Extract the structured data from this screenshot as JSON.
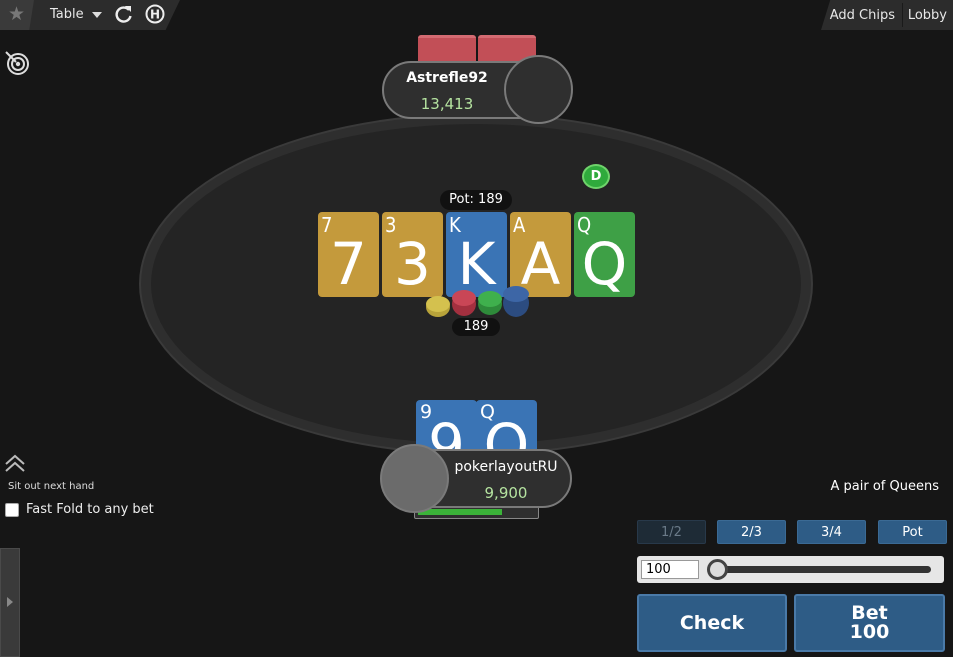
{
  "toolbar": {
    "table_label": "Table",
    "add_chips_label": "Add Chips",
    "lobby_label": "Lobby",
    "icons": [
      "star-icon",
      "caret-down-icon",
      "refresh-icon",
      "history-icon",
      "target-icon"
    ]
  },
  "opponent": {
    "name": "Astrefle92",
    "stack": "13,413"
  },
  "dealer_button": "D",
  "pot": {
    "label": "Pot: 189",
    "chips_amount": "189"
  },
  "board": [
    {
      "rank": "7",
      "color": "#c49a3c"
    },
    {
      "rank": "3",
      "color": "#c49a3c"
    },
    {
      "rank": "K",
      "color": "#3a74b5"
    },
    {
      "rank": "A",
      "color": "#c49a3c"
    },
    {
      "rank": "Q",
      "color": "#3ea046"
    }
  ],
  "hero": {
    "name": "pokerlayoutRU",
    "stack": "9,900",
    "cards": [
      {
        "rank": "9",
        "color": "#3a74b5"
      },
      {
        "rank": "Q",
        "color": "#3a74b5"
      }
    ],
    "timer_fraction": 0.72
  },
  "controls": {
    "sit_out_label": "Sit out next hand",
    "fast_fold_label": "Fast Fold to any bet",
    "hand_description": "A pair of Queens",
    "presets": [
      {
        "label": "1/2",
        "enabled": false
      },
      {
        "label": "2/3",
        "enabled": true
      },
      {
        "label": "3/4",
        "enabled": true
      },
      {
        "label": "Pot",
        "enabled": true
      }
    ],
    "bet_amount": "100",
    "slider_fraction": 0.0,
    "check_label": "Check",
    "bet_label": "Bet",
    "bet_value": "100"
  }
}
